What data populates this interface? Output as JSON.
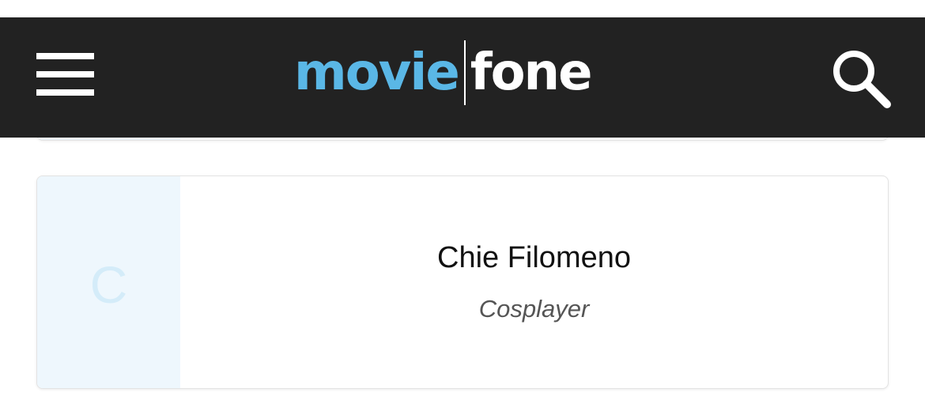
{
  "header": {
    "logo": {
      "part1": "movie",
      "part2": "fone",
      "colors": {
        "part1": "#5ab7e6",
        "part2": "#ffffff"
      }
    },
    "background": "#222222",
    "menu_icon": "hamburger-menu-icon",
    "search_icon": "search-icon"
  },
  "person_card": {
    "initial": "C",
    "name": "Chie Filomeno",
    "role": "Cosplayer",
    "thumb_color": "#eef7fd"
  }
}
